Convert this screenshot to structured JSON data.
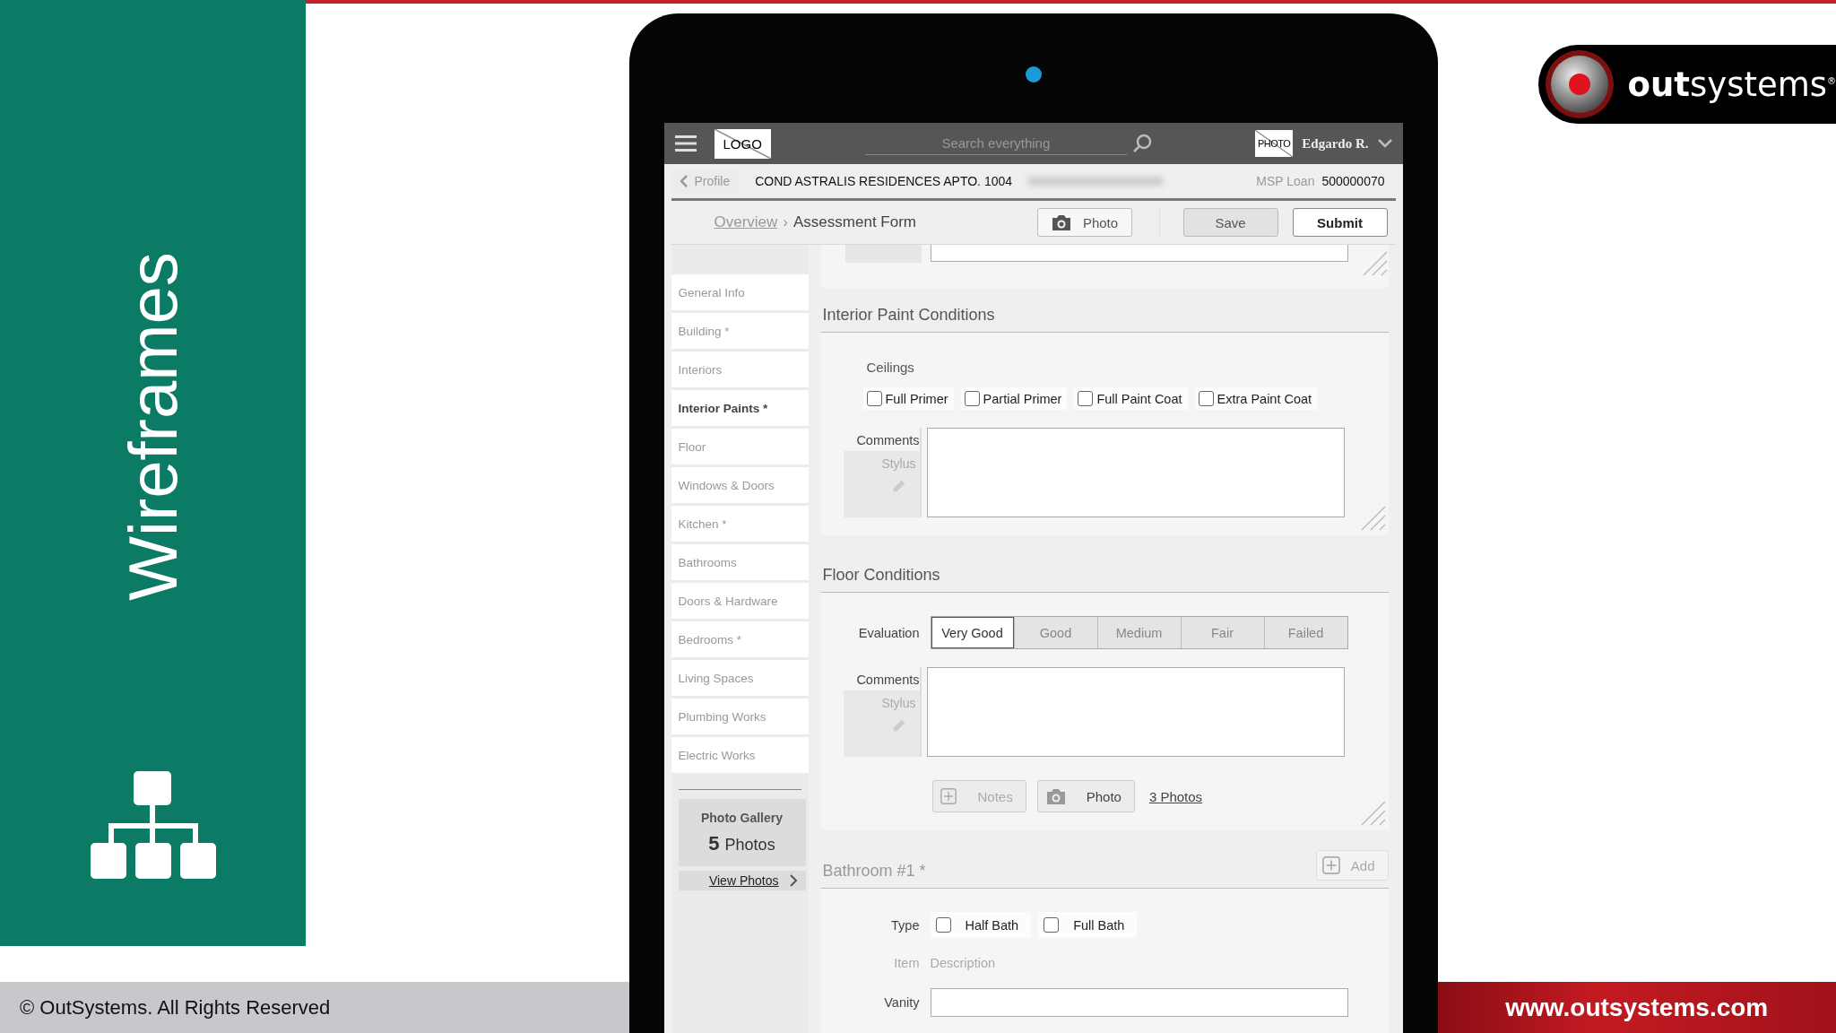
{
  "slide": {
    "title": "Wireframes",
    "copyright": "© OutSystems. All Rights Reserved",
    "website": "www.outsystems.com",
    "brand": "**out**systems$^{®}$"
  },
  "app_bar": {
    "logo": "LOGO",
    "search": {
      "placeholder": "Search everything"
    },
    "avatar": "PHOTO",
    "user": "Edgardo R."
  },
  "info_bar": {
    "back": "Profile",
    "address": "COND ASTRALIS RESIDENCES APTO. 1004",
    "loan_label": "MSP Loan",
    "loan_number": "500000070"
  },
  "breadcrumb": {
    "parent": "Overview",
    "separator": "›",
    "current": "Assessment Form"
  },
  "actions": [
    {
      "label": "Photo",
      "kind": "photo"
    },
    {
      "label": "Save",
      "kind": "secondary"
    },
    {
      "label": "Submit",
      "kind": "primary"
    }
  ],
  "sidebar": {
    "items": [
      {
        "label": "General Info",
        "selected": false
      },
      {
        "label": "Building *",
        "selected": false
      },
      {
        "label": "Interiors",
        "selected": false
      },
      {
        "label": "Interior Paints *",
        "selected": true
      },
      {
        "label": "Floor",
        "selected": false
      },
      {
        "label": "Windows & Doors",
        "selected": false
      },
      {
        "label": "Kitchen *",
        "selected": false
      },
      {
        "label": "Bathrooms",
        "selected": false
      },
      {
        "label": "Doors & Hardware",
        "selected": false
      },
      {
        "label": "Bedrooms *",
        "selected": false
      },
      {
        "label": "Living Spaces",
        "selected": false
      },
      {
        "label": "Plumbing Works",
        "selected": false
      },
      {
        "label": "Electric Works",
        "selected": false
      }
    ],
    "gallery": {
      "title": "Photo Gallery",
      "count": "5",
      "unit": "Photos",
      "link": "View Photos"
    }
  },
  "sections": [
    {
      "title": "Interior Paint Conditions",
      "group_label": "Ceilings",
      "options": [
        {
          "label": "Full Primer",
          "checked": false
        },
        {
          "label": "Partial Primer",
          "checked": false
        },
        {
          "label": "Full Paint Coat",
          "checked": false
        },
        {
          "label": "Extra Paint Coat",
          "checked": false
        }
      ],
      "comments": {
        "label": "Comments",
        "stylus": "Stylus"
      }
    },
    {
      "title": "Floor Conditions",
      "evaluation": {
        "label": "Evaluation",
        "options": [
          {
            "label": "Very Good",
            "selected": true
          },
          {
            "label": "Good",
            "selected": false
          },
          {
            "label": "Medium",
            "selected": false
          },
          {
            "label": "Fair",
            "selected": false
          },
          {
            "label": "Failed",
            "selected": false
          }
        ]
      },
      "comments": {
        "label": "Comments",
        "stylus": "Stylus"
      },
      "notes_button": "Notes",
      "photo_button": "Photo",
      "photos_link": "3 Photos"
    },
    {
      "title": "Bathroom #1 *",
      "add_button": "Add",
      "type_label": "Type",
      "types": [
        {
          "label": "Half Bath",
          "checked": false
        },
        {
          "label": "Full Bath",
          "checked": false
        }
      ],
      "item_header": "Item",
      "description_header": "Description",
      "rows": [
        {
          "label": "Vanity"
        }
      ]
    }
  ]
}
